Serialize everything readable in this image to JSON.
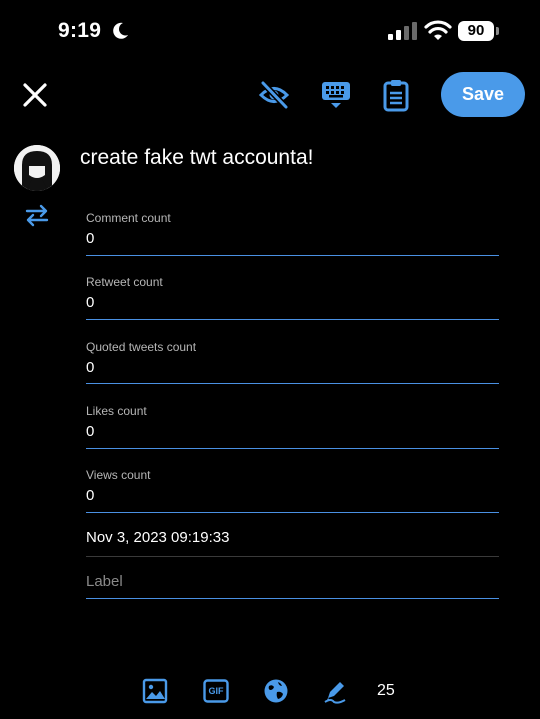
{
  "status_bar": {
    "time": "9:19",
    "battery": "90"
  },
  "toolbar": {
    "save_label": "Save"
  },
  "tweet": {
    "text": "create fake twt accounta!"
  },
  "fields": [
    {
      "label": "Comment count",
      "value": "0"
    },
    {
      "label": "Retweet count",
      "value": "0"
    },
    {
      "label": "Quoted tweets count",
      "value": "0"
    },
    {
      "label": "Likes count",
      "value": "0"
    },
    {
      "label": "Views count",
      "value": "0"
    }
  ],
  "date": "Nov 3, 2023 09:19:33",
  "label_field": {
    "placeholder": "Label"
  },
  "bottom_bar": {
    "count": "25",
    "gif_label": "GIF"
  },
  "colors": {
    "accent": "#4a9ae9",
    "background": "#000000",
    "divider": "#3a3a3a"
  }
}
